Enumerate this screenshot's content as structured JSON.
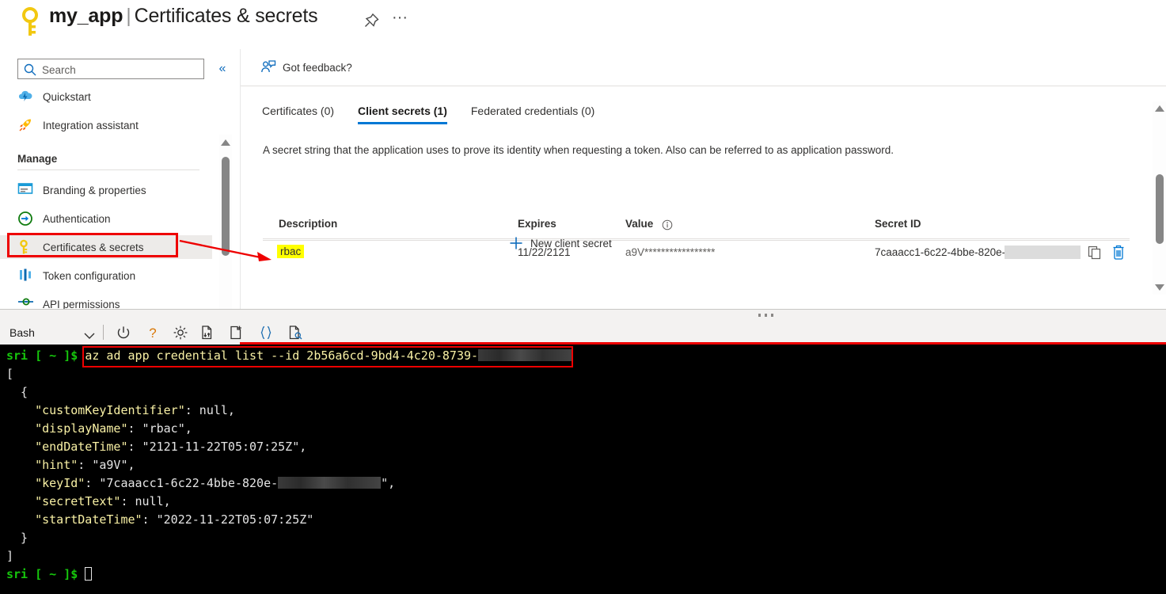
{
  "titlebar": {
    "key_icon": "key-icon",
    "app_name": "my_app",
    "separator": "|",
    "page_name": "Certificates & secrets",
    "pin_icon": "pin-icon",
    "more_label": "···"
  },
  "sidebar": {
    "search": {
      "placeholder": "Search",
      "value": "",
      "icon": "search-icon"
    },
    "collapse_label": "«",
    "items": [
      {
        "label": "Quickstart",
        "icon": "cloud-lightning-icon",
        "selected": false
      },
      {
        "label": "Integration assistant",
        "icon": "rocket-icon",
        "selected": false
      },
      {
        "label": "Branding & properties",
        "icon": "branding-icon",
        "selected": false
      },
      {
        "label": "Authentication",
        "icon": "authentication-icon",
        "selected": false
      },
      {
        "label": "Certificates & secrets",
        "icon": "key-icon",
        "selected": true
      },
      {
        "label": "Token configuration",
        "icon": "token-icon",
        "selected": false
      },
      {
        "label": "API permissions",
        "icon": "api-permissions-icon",
        "selected": false
      }
    ],
    "section_label": "Manage"
  },
  "content": {
    "feedback": {
      "label": "Got feedback?",
      "icon": "feedback-person-icon"
    },
    "tabs": [
      {
        "label": "Certificates (0)",
        "active": false
      },
      {
        "label": "Client secrets (1)",
        "active": true
      },
      {
        "label": "Federated credentials (0)",
        "active": false
      }
    ],
    "description": "A secret string that the application uses to prove its identity when requesting a token. Also can be referred to as application password.",
    "new_secret_label": "New client secret",
    "table": {
      "columns": [
        "Description",
        "Expires",
        "Value",
        "Secret ID"
      ],
      "value_info_icon": "info-icon",
      "rows": [
        {
          "description": "rbac",
          "expires": "11/22/2121",
          "value": "a9V*****************",
          "secret_id": "7caaacc1-6c22-4bbe-820e-",
          "secret_id_redacted": true,
          "copy_icon": "copy-icon",
          "delete_icon": "trash-icon"
        }
      ]
    }
  },
  "terminal": {
    "shell": "Bash",
    "toolbar_icons": [
      "power-icon",
      "help-icon",
      "settings-icon",
      "upload-download-icon",
      "new-file-icon",
      "braces-icon",
      "open-file-icon"
    ],
    "prompt": "sri [ ~ ]$ ",
    "command": "az ad app credential list --id 2b56a6cd-9bd4-4c20-8739-",
    "output_lines": [
      {
        "indent": 0,
        "parts": [
          {
            "t": "[",
            "c": "white"
          }
        ]
      },
      {
        "indent": 1,
        "parts": [
          {
            "t": "{",
            "c": "white"
          }
        ]
      },
      {
        "indent": 2,
        "parts": [
          {
            "t": "\"customKeyIdentifier\"",
            "c": "key"
          },
          {
            "t": ": ",
            "c": "white"
          },
          {
            "t": "null,",
            "c": "white"
          }
        ]
      },
      {
        "indent": 2,
        "parts": [
          {
            "t": "\"displayName\"",
            "c": "key"
          },
          {
            "t": ": ",
            "c": "white"
          },
          {
            "t": "\"rbac\",",
            "c": "white"
          }
        ]
      },
      {
        "indent": 2,
        "parts": [
          {
            "t": "\"endDateTime\"",
            "c": "key"
          },
          {
            "t": ": ",
            "c": "white"
          },
          {
            "t": "\"2121-11-22T05:07:25Z\",",
            "c": "white"
          }
        ]
      },
      {
        "indent": 2,
        "parts": [
          {
            "t": "\"hint\"",
            "c": "key"
          },
          {
            "t": ": ",
            "c": "white"
          },
          {
            "t": "\"a9V\",",
            "c": "white"
          }
        ]
      },
      {
        "indent": 2,
        "parts": [
          {
            "t": "\"keyId\"",
            "c": "key"
          },
          {
            "t": ": ",
            "c": "white"
          },
          {
            "t": "\"7caaacc1-6c22-4bbe-820e-",
            "c": "white"
          },
          {
            "t": "REDACT",
            "c": "redact"
          },
          {
            "t": "\",",
            "c": "white"
          }
        ]
      },
      {
        "indent": 2,
        "parts": [
          {
            "t": "\"secretText\"",
            "c": "key"
          },
          {
            "t": ": ",
            "c": "white"
          },
          {
            "t": "null,",
            "c": "white"
          }
        ]
      },
      {
        "indent": 2,
        "parts": [
          {
            "t": "\"startDateTime\"",
            "c": "key"
          },
          {
            "t": ": ",
            "c": "white"
          },
          {
            "t": "\"2022-11-22T05:07:25Z\"",
            "c": "white"
          }
        ]
      },
      {
        "indent": 1,
        "parts": [
          {
            "t": "}",
            "c": "white"
          }
        ]
      },
      {
        "indent": 0,
        "parts": [
          {
            "t": "]",
            "c": "white"
          }
        ]
      }
    ],
    "final_prompt": "sri [ ~ ]$ "
  },
  "colors": {
    "accent": "#0078d4",
    "annotation_red": "#ee0000",
    "highlight_yellow": "#ffff00",
    "terminal_bg": "#000000",
    "terminal_green": "#16c60c",
    "terminal_key_yellow": "#f9f1a5"
  }
}
